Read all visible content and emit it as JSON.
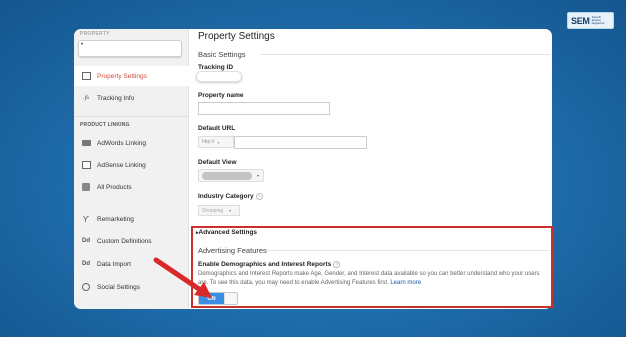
{
  "brand": {
    "logo_text": "SEM",
    "logo_sub": "Search Engine Magazine"
  },
  "sidebar": {
    "property_label": "PROPERTY",
    "property_value": "",
    "items_top": [
      {
        "label": "Property Settings",
        "icon": "table-icon"
      },
      {
        "label": "Tracking Info",
        "icon": "js-icon"
      }
    ],
    "section_product_linking": "PRODUCT LINKING",
    "items_linking": [
      {
        "label": "AdWords Linking",
        "icon": "adwords-icon"
      },
      {
        "label": "AdSense Linking",
        "icon": "adsense-icon"
      },
      {
        "label": "All Products",
        "icon": "all-products-icon"
      }
    ],
    "items_bottom": [
      {
        "label": "Remarketing",
        "icon": "remarketing-icon"
      },
      {
        "label": "Custom Definitions",
        "icon": "dd-icon"
      },
      {
        "label": "Data Import",
        "icon": "dd-icon"
      },
      {
        "label": "Social Settings",
        "icon": "globe-icon"
      }
    ]
  },
  "content": {
    "page_title": "Property Settings",
    "basic_settings": "Basic Settings",
    "tracking_id_label": "Tracking ID",
    "property_name_label": "Property name",
    "default_url_label": "Default URL",
    "default_url_protocol": "http://",
    "default_view_label": "Default View",
    "industry_category_label": "Industry Category",
    "industry_category_value": "Shopping",
    "advanced_settings": "Advanced Settings",
    "advertising_features": "Advertising Features",
    "demographics_title": "Enable Demographics and Interest Reports",
    "demographics_desc": "Demographics and Interest Reports make Age, Gender, and Interest data available so you can better understand who your users are. To see this data, you may need to enable Advertising Features first.",
    "learn_more": "Learn more",
    "toggle_on": "ON"
  },
  "colors": {
    "background": "#1f6fae",
    "highlight": "#c9302c",
    "active_nav": "#d14836",
    "toggle_on": "#3a8ee6",
    "arrow": "#d9292a"
  }
}
